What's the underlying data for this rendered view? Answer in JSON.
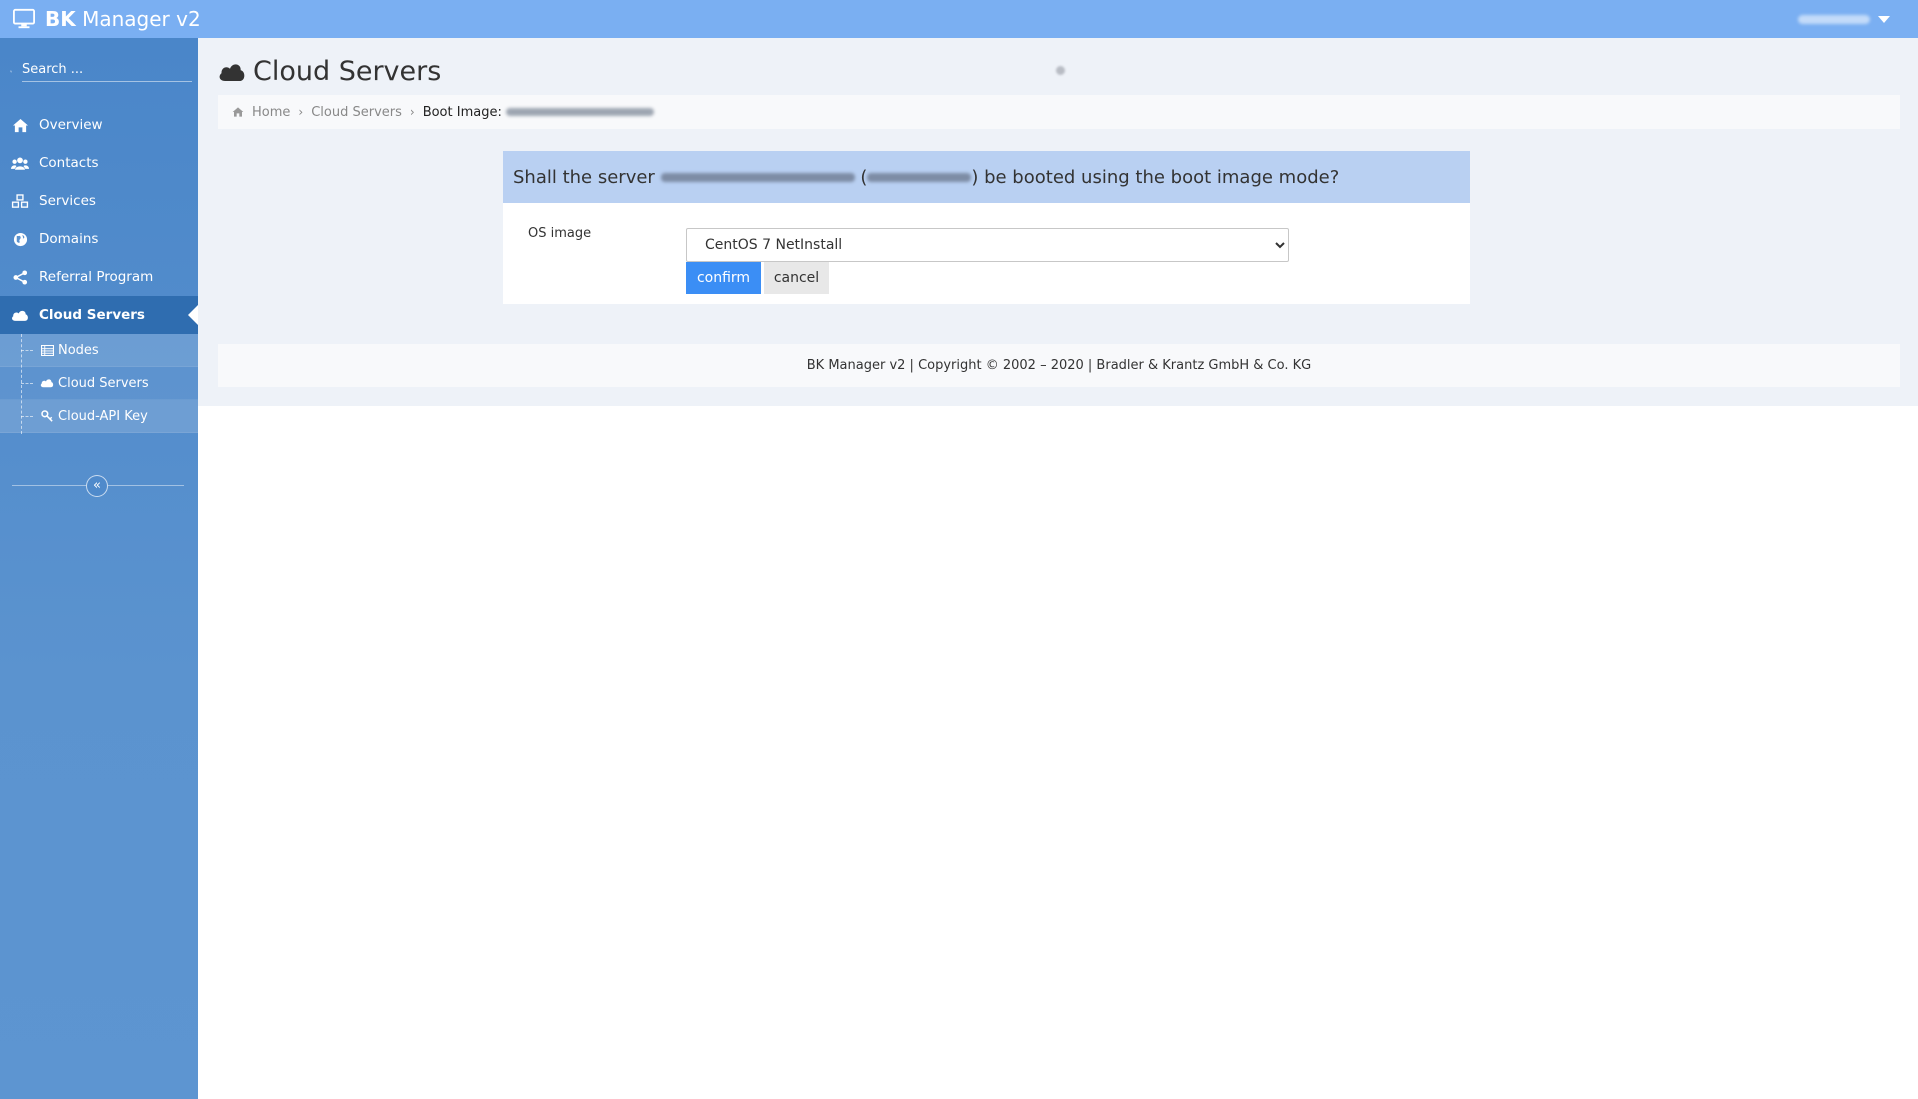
{
  "app": {
    "brand_bold": "BK",
    "brand_rest": " Manager v2"
  },
  "sidebar": {
    "search_placeholder": "Search ...",
    "items": [
      {
        "label": "Overview",
        "icon": "home-icon"
      },
      {
        "label": "Contacts",
        "icon": "users-icon"
      },
      {
        "label": "Services",
        "icon": "cubes-icon"
      },
      {
        "label": "Domains",
        "icon": "globe-icon"
      },
      {
        "label": "Referral Program",
        "icon": "share-icon"
      },
      {
        "label": "Cloud Servers",
        "icon": "cloud-icon",
        "active": true
      }
    ],
    "subitems": [
      {
        "label": "Nodes",
        "icon": "list-icon"
      },
      {
        "label": "Cloud Servers",
        "icon": "cloud-icon"
      },
      {
        "label": "Cloud-API Key",
        "icon": "key-icon"
      }
    ],
    "collapse_symbol": "«"
  },
  "page": {
    "title": "Cloud Servers"
  },
  "breadcrumb": {
    "home": "Home",
    "cloud_servers": "Cloud Servers",
    "current_prefix": "Boot Image:"
  },
  "dialog": {
    "question_prefix": "Shall the server",
    "question_mid_open": "(",
    "question_suffix": ") be booted using the boot image mode?",
    "os_label": "OS image",
    "os_selected": "CentOS 7 NetInstall",
    "confirm_label": "confirm",
    "cancel_label": "cancel"
  },
  "footer": {
    "text": "BK Manager v2 | Copyright © 2002 – 2020 | Bradler & Krantz GmbH & Co. KG"
  },
  "colors": {
    "topbar": "#7aaff2",
    "sidebar": "#4a86c9",
    "active_nav": "#2f6db0",
    "dialog_header": "#b9d0f2",
    "confirm_button": "#3b8ef5"
  }
}
